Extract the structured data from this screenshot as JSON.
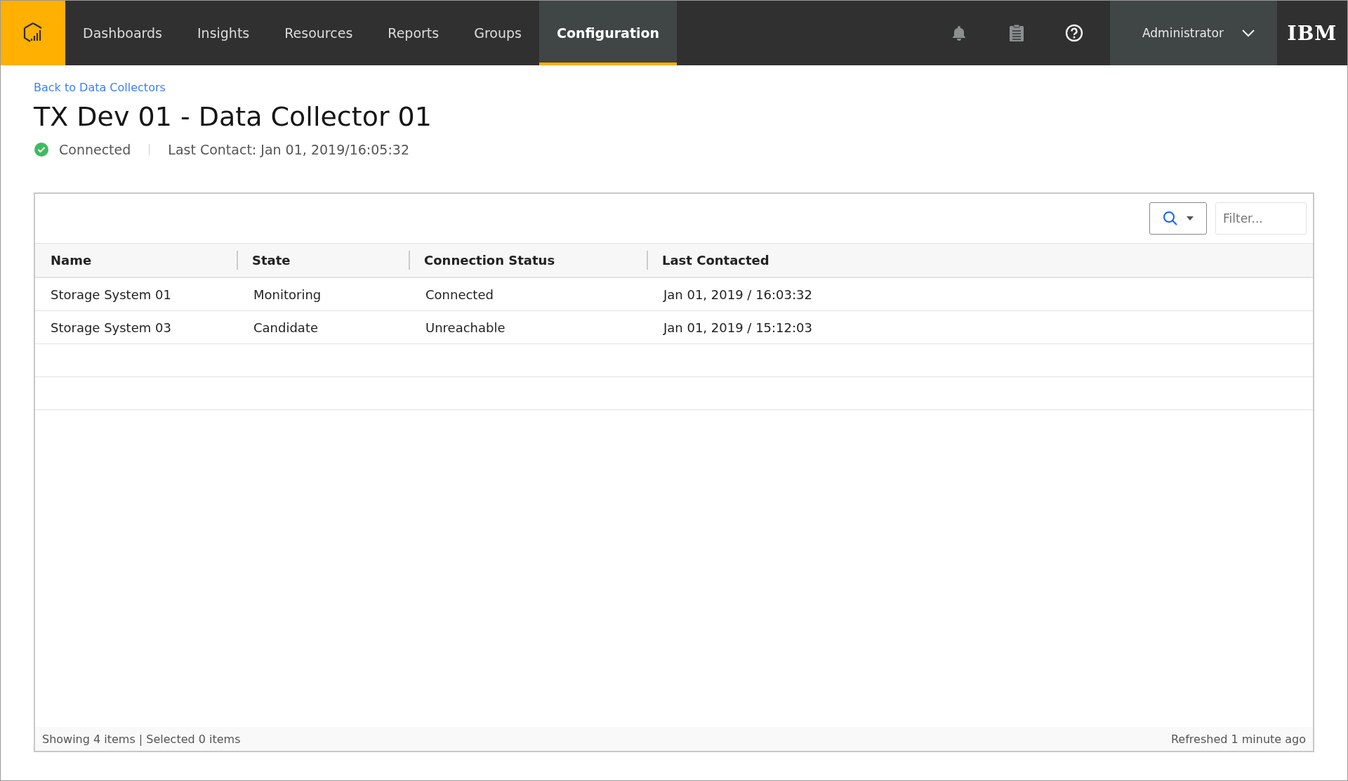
{
  "nav": {
    "items": [
      {
        "label": "Dashboards",
        "selected": false
      },
      {
        "label": "Insights",
        "selected": false
      },
      {
        "label": "Resources",
        "selected": false
      },
      {
        "label": "Reports",
        "selected": false
      },
      {
        "label": "Groups",
        "selected": false
      },
      {
        "label": "Configuration",
        "selected": true
      }
    ],
    "user": "Administrator",
    "brand": "IBM"
  },
  "back_link": "Back to Data Collectors",
  "title": "TX Dev 01 - Data Collector 01",
  "status": {
    "kind": "connected",
    "label": "Connected",
    "last_contact": "Last Contact: Jan 01, 2019/16:05:32"
  },
  "table": {
    "filter": {
      "placeholder": "Filter..."
    },
    "columns": [
      "Name",
      "State",
      "Connection Status",
      "Last Contacted"
    ],
    "rows": [
      [
        "Storage System 01",
        "Monitoring",
        "Connected",
        "Jan 01, 2019 / 16:03:32"
      ],
      [
        "Storage System 03",
        "Candidate",
        "Unreachable",
        "Jan 01, 2019 / 15:12:03"
      ],
      [],
      []
    ],
    "footer_left": "Showing 4 items | Selected 0 items",
    "footer_right": "Refreshed 1 minute ago"
  }
}
